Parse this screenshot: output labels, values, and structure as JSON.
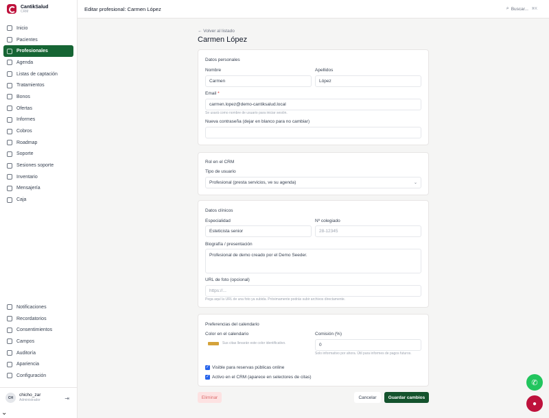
{
  "brand": {
    "name": "CantikSalud",
    "sub": "CRM"
  },
  "nav": [
    {
      "label": "Inicio",
      "icon": "home-icon"
    },
    {
      "label": "Pacientes",
      "icon": "users-icon"
    },
    {
      "label": "Profesionales",
      "icon": "id-card-icon",
      "active": true
    },
    {
      "label": "Agenda",
      "icon": "calendar-icon"
    },
    {
      "label": "Listas de captación",
      "icon": "list-icon"
    },
    {
      "label": "Tratamientos",
      "icon": "sparkle-icon"
    },
    {
      "label": "Bonos",
      "icon": "ticket-icon"
    },
    {
      "label": "Ofertas",
      "icon": "tag-icon"
    },
    {
      "label": "Informes",
      "icon": "chart-icon"
    },
    {
      "label": "Cobros",
      "icon": "coin-icon"
    },
    {
      "label": "Roadmap",
      "icon": "map-icon"
    },
    {
      "label": "Soporte",
      "icon": "lifebuoy-icon"
    },
    {
      "label": "Sesiones soporte",
      "icon": "headset-icon"
    },
    {
      "label": "Inventario",
      "icon": "box-icon"
    },
    {
      "label": "Mensajería",
      "icon": "message-icon"
    },
    {
      "label": "Caja",
      "icon": "cash-register-icon"
    }
  ],
  "nav_bottom": [
    {
      "label": "Notificaciones",
      "icon": "mail-icon"
    },
    {
      "label": "Recordatorios",
      "icon": "clock-icon"
    },
    {
      "label": "Consentimientos",
      "icon": "file-icon"
    },
    {
      "label": "Campos",
      "icon": "folder-icon"
    },
    {
      "label": "Auditoría",
      "icon": "shield-icon"
    },
    {
      "label": "Apariencia",
      "icon": "palette-icon"
    },
    {
      "label": "Configuración",
      "icon": "gear-icon"
    }
  ],
  "user": {
    "initials": "CH",
    "name": "chicho_zar",
    "role": "Administrador"
  },
  "header": {
    "title": "Editar profesional: Carmen López",
    "search_placeholder": "Buscar...",
    "shortcut": "⌘K"
  },
  "page": {
    "back": "← Volver al listado",
    "title": "Carmen López"
  },
  "personal": {
    "title": "Datos personales",
    "name_label": "Nombre",
    "name_value": "Carmen",
    "surname_label": "Apellidos",
    "surname_value": "López",
    "email_label": "Email",
    "email_required": "*",
    "email_value": "carmen.lopez@demo-cantiksalud.local",
    "email_hint": "Se usará como nombre de usuario para iniciar sesión.",
    "password_label": "Nueva contraseña (dejar en blanco para no cambiar)",
    "password_value": ""
  },
  "role": {
    "title": "Rol en el CRM",
    "type_label": "Tipo de usuario",
    "type_value": "Profesional (presta servicios, ve su agenda)"
  },
  "clinical": {
    "title": "Datos clínicos",
    "specialty_label": "Especialidad",
    "specialty_value": "Esteticista senior",
    "license_label": "Nº colegiado",
    "license_placeholder": "28-12345",
    "bio_label": "Biografía / presentación",
    "bio_value": "Profesional de demo creado por el Demo Seeder.",
    "photo_label": "URL de foto (opcional)",
    "photo_placeholder": "https://...",
    "photo_hint": "Pega aquí la URL de una foto ya subida. Próximamente podrás subir archivos directamente."
  },
  "calendar": {
    "title": "Preferencias del calendario",
    "color_label": "Color en el calendario",
    "color_value": "#d4a23a",
    "color_hint": "Sus citas llevarán este color identificativo.",
    "commission_label": "Comisión (%)",
    "commission_value": "0",
    "commission_hint": "Solo informativo por ahora. Útil para informes de pagos futuros.",
    "online_label": "Visible para reservas públicas online",
    "online_checked": true,
    "active_label": "Activo en el CRM (aparece en selectores de citas)",
    "active_checked": true
  },
  "actions": {
    "delete": "Eliminar",
    "cancel": "Cancelar",
    "save": "Guardar cambios"
  }
}
